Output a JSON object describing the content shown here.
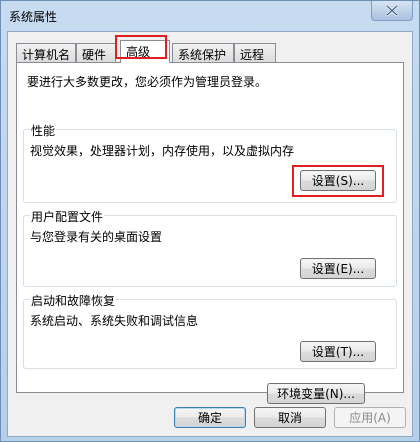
{
  "window": {
    "title": "系统属性"
  },
  "tabs": [
    {
      "label": "计算机名",
      "active": false
    },
    {
      "label": "硬件",
      "active": false
    },
    {
      "label": "高级",
      "active": true
    },
    {
      "label": "系统保护",
      "active": false
    },
    {
      "label": "远程",
      "active": false
    }
  ],
  "advanced": {
    "admin_note": "要进行大多数更改，您必须作为管理员登录。",
    "performance": {
      "title": "性能",
      "description": "视觉效果，处理器计划，内存使用，以及虚拟内存",
      "button": "设置(S)..."
    },
    "user_profiles": {
      "title": "用户配置文件",
      "description": "与您登录有关的桌面设置",
      "button": "设置(E)..."
    },
    "startup_recovery": {
      "title": "启动和故障恢复",
      "description": "系统启动、系统失败和调试信息",
      "button": "设置(T)..."
    },
    "env_button": "环境变量(N)..."
  },
  "footer": {
    "ok": "确定",
    "cancel": "取消",
    "apply": "应用(A)"
  },
  "colors": {
    "highlight": "#e02020",
    "title_bar": "#c7dbf1"
  },
  "icons": {
    "close": "close-icon"
  }
}
